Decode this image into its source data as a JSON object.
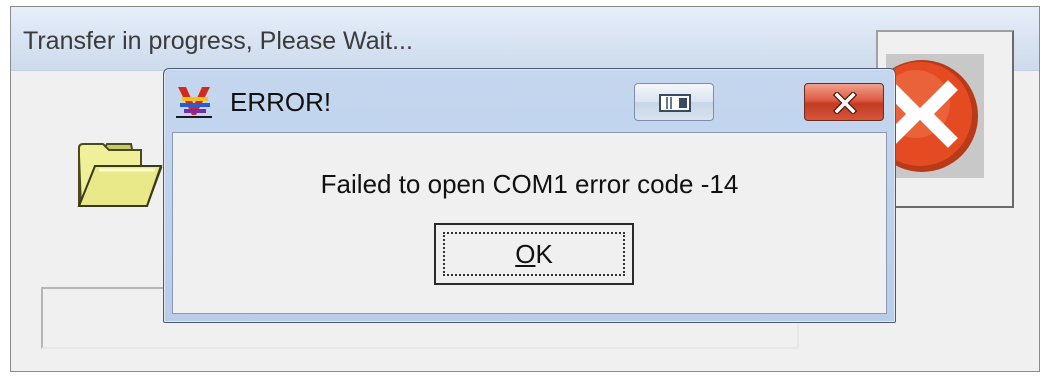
{
  "background_window": {
    "title": "Transfer in progress, Please Wait...",
    "icons": {
      "folder": "folder-icon",
      "cancel": "cancel-x-icon"
    }
  },
  "error_dialog": {
    "title": "ERROR!",
    "message": "Failed to open COM1 error code -14",
    "ok_button": {
      "mnemonic": "O",
      "rest": "K"
    },
    "icons": {
      "app": "app-logo-icon",
      "restore": "restore-icon",
      "close": "close-icon"
    }
  },
  "colors": {
    "close_button": "#d6563a",
    "cancel_icon": "#e54b22",
    "folder": "#e9e98a"
  }
}
